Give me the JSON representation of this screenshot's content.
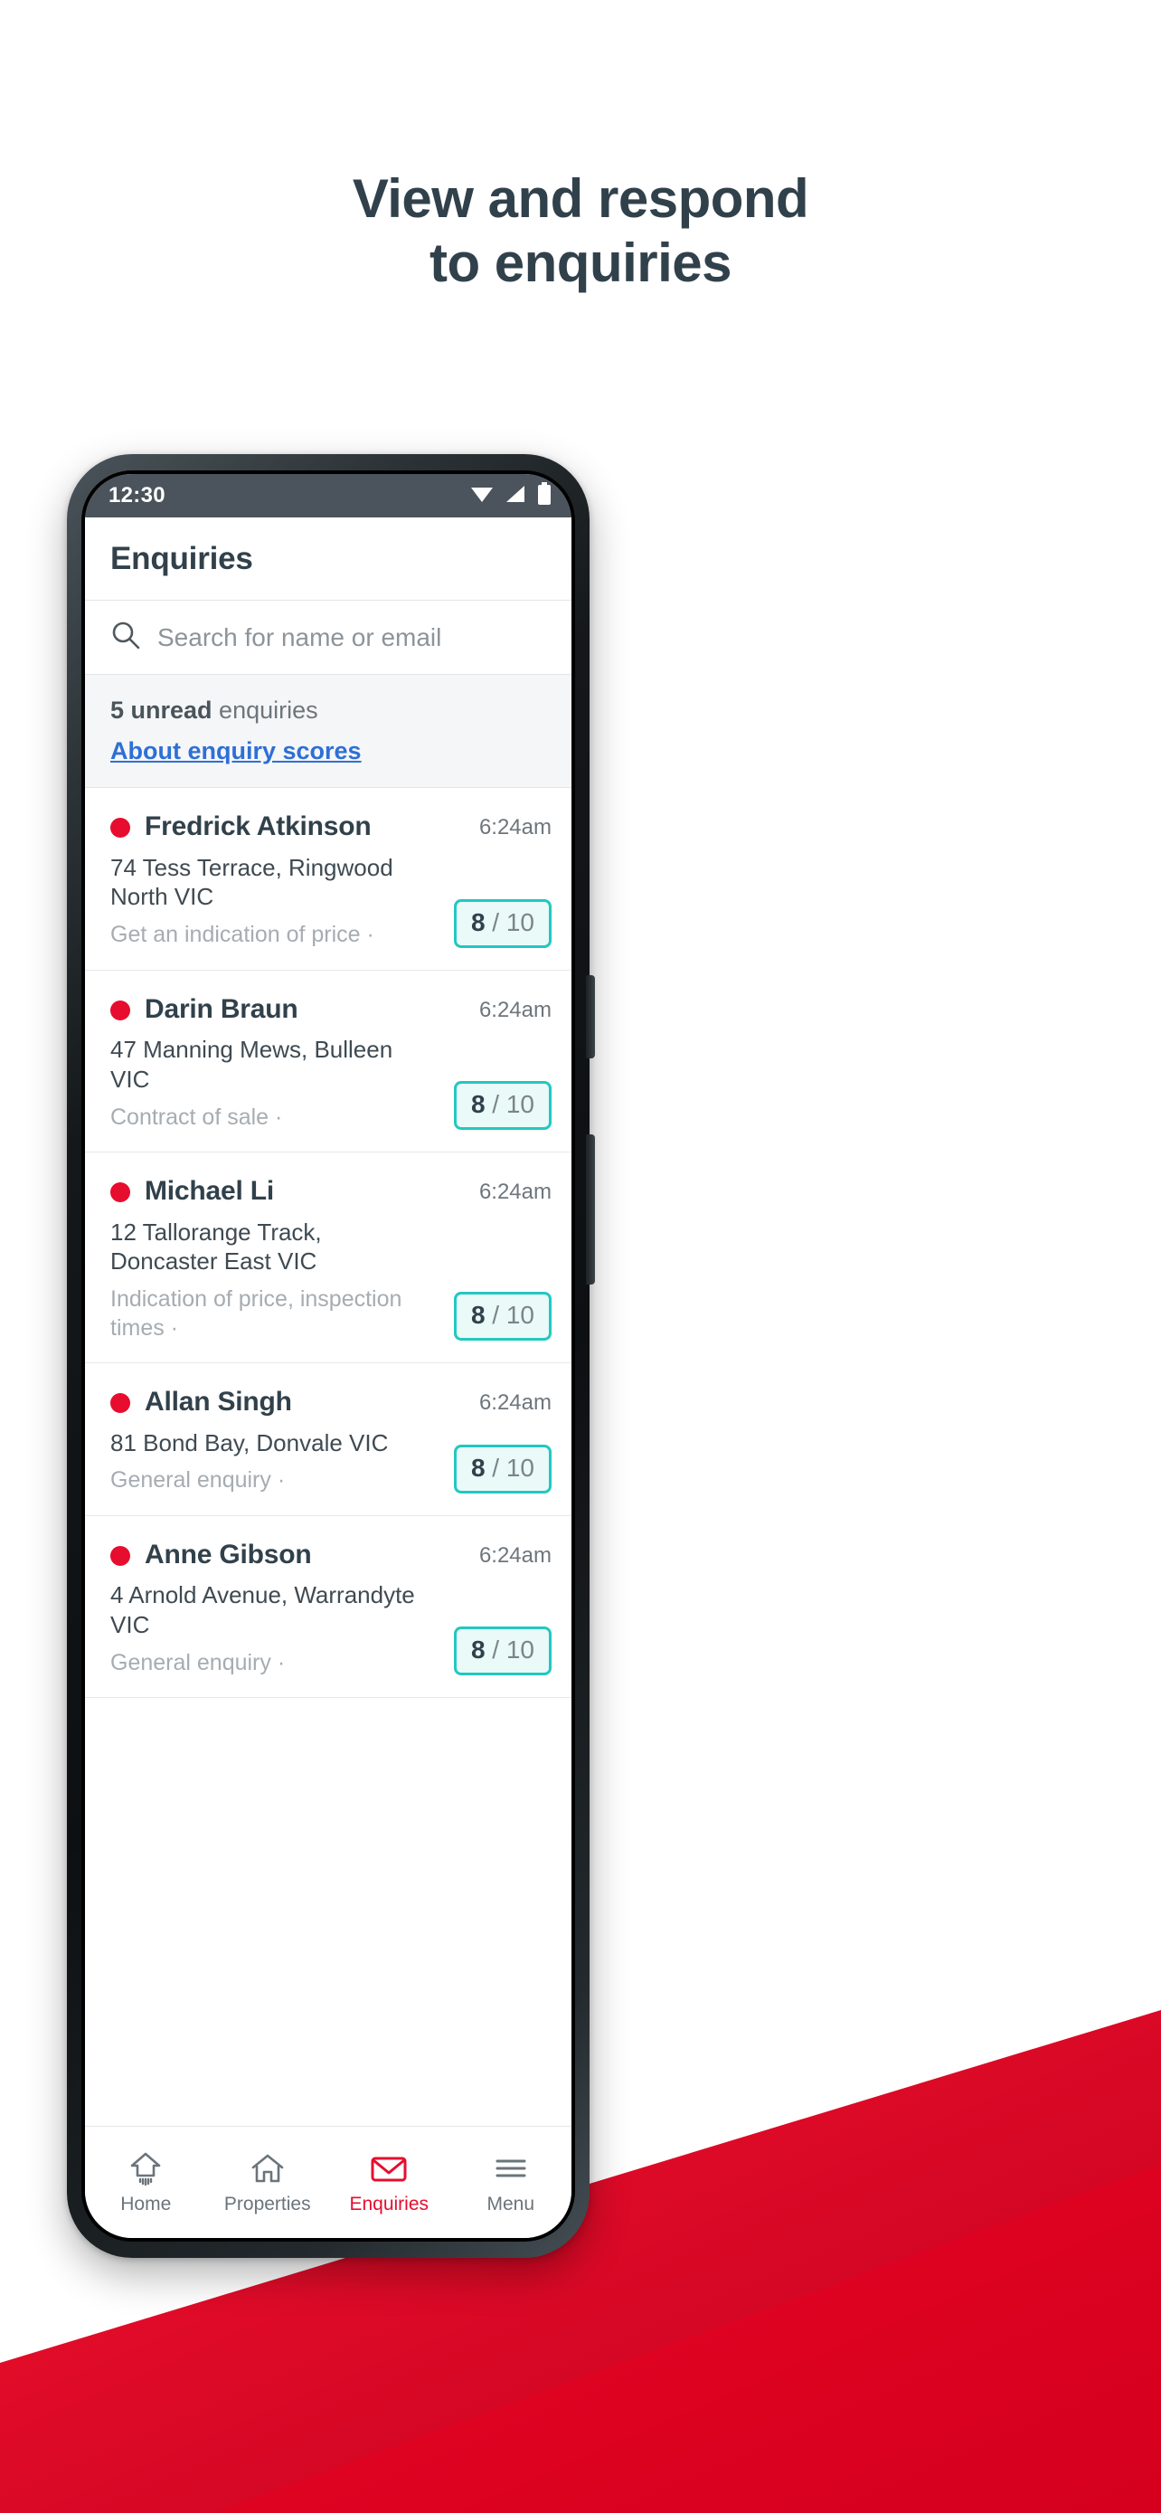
{
  "headline": {
    "line1": "View and respond",
    "line2": "to enquiries",
    "color": "#31414B"
  },
  "phone": {
    "status_bar": {
      "time": "12:30",
      "background": "#4B545C",
      "icons": [
        "wifi-icon",
        "signal-icon",
        "battery-icon"
      ]
    },
    "app": {
      "title": "Enquiries",
      "search": {
        "icon": "search-icon",
        "placeholder": "Search for name or email",
        "value": ""
      },
      "banner": {
        "count_text": "5 unread",
        "suffix_text": " enquiries",
        "link_label": "About enquiry scores",
        "link_color": "#2E6FD6"
      },
      "enquiries": [
        {
          "unread": true,
          "name": "Fredrick Atkinson",
          "address": "74 Tess Terrace, Ringwood North VIC",
          "type": "Get an indication of price ·",
          "time": "6:24am",
          "score_value": "8",
          "score_max": "/ 10"
        },
        {
          "unread": true,
          "name": "Darin Braun",
          "address": "47 Manning Mews, Bulleen VIC",
          "type": "Contract of sale ·",
          "time": "6:24am",
          "score_value": "8",
          "score_max": "/ 10"
        },
        {
          "unread": true,
          "name": "Michael Li",
          "address": "12 Tallorange Track, Doncaster East VIC",
          "type": "Indication of price, inspection times ·",
          "time": "6:24am",
          "score_value": "8",
          "score_max": "/ 10"
        },
        {
          "unread": true,
          "name": "Allan Singh",
          "address": "81 Bond Bay, Donvale VIC",
          "type": "General enquiry ·",
          "time": "6:24am",
          "score_value": "8",
          "score_max": "/ 10"
        },
        {
          "unread": true,
          "name": "Anne Gibson",
          "address": "4 Arnold Avenue, Warrandyte VIC",
          "type": "General enquiry ·",
          "time": "6:24am",
          "score_value": "8",
          "score_max": "/ 10"
        }
      ],
      "bottom_nav": [
        {
          "label": "Home",
          "icon": "home-upload-icon",
          "active": false
        },
        {
          "label": "Properties",
          "icon": "house-icon",
          "active": false
        },
        {
          "label": "Enquiries",
          "icon": "envelope-icon",
          "active": true
        },
        {
          "label": "Menu",
          "icon": "hamburger-icon",
          "active": false
        }
      ]
    }
  },
  "theme": {
    "unread_dot": "#E60D2E",
    "score_border": "#22C8C0",
    "score_fill": "#E9FAF9",
    "accent_red": "#E60D2E",
    "brand_red_dark": "#C8102E"
  }
}
